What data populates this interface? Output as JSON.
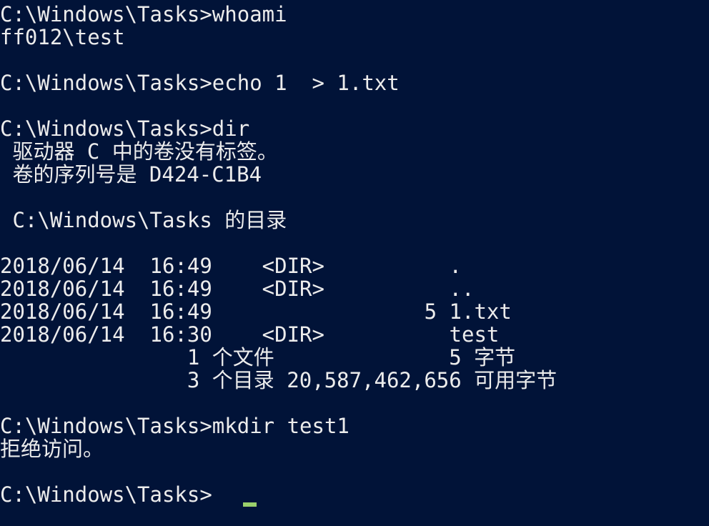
{
  "terminal": {
    "prompt": "C:\\Windows\\Tasks>",
    "lines": [
      "C:\\Windows\\Tasks>whoami",
      "ff012\\test",
      "",
      "C:\\Windows\\Tasks>echo 1  > 1.txt",
      "",
      "C:\\Windows\\Tasks>dir",
      " 驱动器 C 中的卷没有标签。",
      " 卷的序列号是 D424-C1B4",
      "",
      " C:\\Windows\\Tasks 的目录",
      "",
      "2018/06/14  16:49    <DIR>          .",
      "2018/06/14  16:49    <DIR>          ..",
      "2018/06/14  16:49                 5 1.txt",
      "2018/06/14  16:30    <DIR>          test",
      "               1 个文件              5 字节",
      "               3 个目录 20,587,462,656 可用字节",
      "",
      "C:\\Windows\\Tasks>mkdir test1",
      "拒绝访问。",
      "",
      "C:\\Windows\\Tasks>"
    ]
  },
  "colors": {
    "background": "#011338",
    "text": "#ececec",
    "cursor": "#9ad06b"
  }
}
